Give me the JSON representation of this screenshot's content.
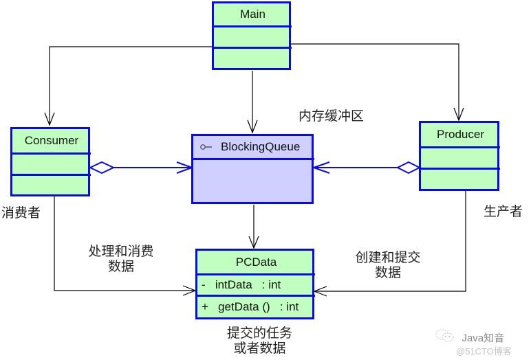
{
  "colors": {
    "class_fill": "#c0ffc0",
    "interface_fill": "#cfd0ff",
    "border": "#0a0ae6",
    "dependency_line": "#000000",
    "aggregation_line": "#0a0ae6"
  },
  "classes": {
    "main": {
      "name": "Main",
      "attributes": [],
      "operations": []
    },
    "consumer": {
      "name": "Consumer",
      "attributes": [],
      "operations": []
    },
    "producer": {
      "name": "Producer",
      "attributes": [],
      "operations": []
    },
    "blocking_queue": {
      "name": "BlockingQueue",
      "stereotype_icon": "interface-lollipop-icon",
      "attributes": []
    },
    "pcdata": {
      "name": "PCData",
      "attributes": [
        {
          "visibility": "-",
          "text": "-   intData   : int"
        }
      ],
      "operations": [
        {
          "visibility": "+",
          "text": "+   getData ()   : int"
        }
      ]
    }
  },
  "labels": {
    "buffer": "内存缓冲区",
    "consumer_role": "消费者",
    "producer_role": "生产者",
    "consume_line1": "处理和消费",
    "consume_line2": "数据",
    "produce_line1": "创建和提交",
    "produce_line2": "数据",
    "task_line1": "提交的任务",
    "task_line2": "或者数据"
  },
  "relations": [
    {
      "from": "Main",
      "to": "Consumer",
      "type": "dependency"
    },
    {
      "from": "Main",
      "to": "BlockingQueue",
      "type": "dependency"
    },
    {
      "from": "Main",
      "to": "Producer",
      "type": "dependency"
    },
    {
      "from": "Consumer",
      "to": "BlockingQueue",
      "type": "aggregation"
    },
    {
      "from": "Producer",
      "to": "BlockingQueue",
      "type": "aggregation"
    },
    {
      "from": "BlockingQueue",
      "to": "PCData",
      "type": "dependency"
    },
    {
      "from": "Consumer",
      "to": "PCData",
      "type": "dependency"
    },
    {
      "from": "Producer",
      "to": "PCData",
      "type": "dependency"
    }
  ],
  "watermark": {
    "line1": "Java知音",
    "line2": "@51CTO博客",
    "icon": "wechat-icon"
  }
}
